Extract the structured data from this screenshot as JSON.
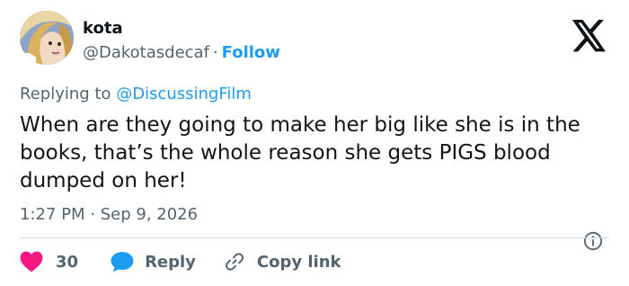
{
  "user": {
    "name": "kota",
    "handle": "@Dakotasdecaf",
    "follow_label": "Follow"
  },
  "tweet": {
    "replying_prefix": "Replying to",
    "replying_to": "@DiscussingFilm",
    "text": "When are they going to make her big like she is in the books, that’s the whole reason she gets PIGS blood dumped on her!",
    "time": "1:27 PM",
    "date": "Sep 9, 2026",
    "separator": "·"
  },
  "actions": {
    "likes": "30",
    "reply_label": "Reply",
    "copy_link_label": "Copy link"
  },
  "colors": {
    "accent": "#1d9bf0",
    "like": "#f91880",
    "muted": "#536471",
    "text": "#0f1419"
  },
  "icons": {
    "brand": "x-logo-icon",
    "like": "heart-icon",
    "reply": "speech-bubble-icon",
    "copy": "link-icon",
    "info": "info-icon"
  }
}
